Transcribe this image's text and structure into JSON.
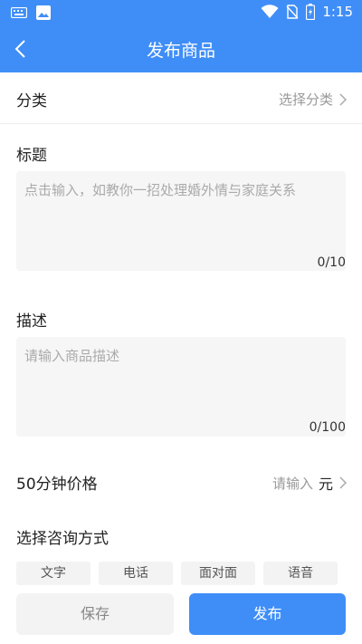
{
  "status_bar": {
    "time": "1:15",
    "icons": [
      "keyboard-icon",
      "image-icon",
      "wifi-icon",
      "no-sim-icon",
      "battery-icon"
    ]
  },
  "header": {
    "title": "发布商品",
    "back_icon": "chevron-left-icon"
  },
  "form": {
    "category": {
      "label": "分类",
      "value_placeholder": "选择分类"
    },
    "title": {
      "label": "标题",
      "placeholder": "点击输入，如教你一招处理婚外情与家庭关系",
      "counter": "0/10"
    },
    "description": {
      "label": "描述",
      "placeholder": "请输入商品描述",
      "counter": "0/100"
    },
    "price": {
      "label": "50分钟价格",
      "placeholder": "请输入",
      "unit": "元"
    },
    "consult": {
      "label": "选择咨询方式",
      "options": [
        "文字",
        "电话",
        "面对面",
        "语音"
      ]
    }
  },
  "actions": {
    "save_label": "保存",
    "publish_label": "发布"
  },
  "colors": {
    "primary": "#3f8ef7",
    "input_bg": "#f6f6f6",
    "chip_bg": "#f3f3f3",
    "muted_text": "#999999"
  }
}
